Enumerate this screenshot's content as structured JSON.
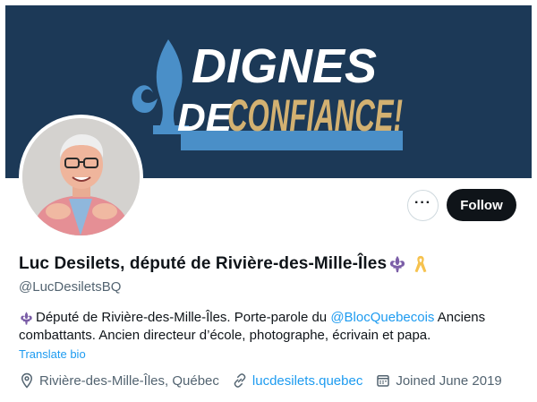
{
  "banner": {
    "line1": "DIGNES",
    "line2_prefix": "DE",
    "line2_main": "CONFIANCE!",
    "colors": {
      "background": "#1c3957",
      "text_white": "#ffffff",
      "text_gold": "#d3b171",
      "accent_blue": "#4a8fc8"
    }
  },
  "profile": {
    "avatar_icon": "profile-photo",
    "more_icon": "more-horizontal-icon",
    "more_label": "···",
    "follow_label": "Follow",
    "display_name": "Luc Desilets, député de Rivière-des-Mille-Îles",
    "name_emojis": [
      "fleur-de-lis-icon",
      "yellow-ribbon-icon"
    ],
    "handle": "@LucDesiletsBQ",
    "bio": {
      "prefix_icon": "fleur-de-lis-icon",
      "text_before_mention": "Député de Rivière-des-Mille-Îles. Porte-parole du ",
      "mention": "@BlocQuebecois",
      "text_after_mention": " Anciens",
      "line2": "combattants. Ancien directeur d’école, photographe, écrivain et papa."
    },
    "translate_label": "Translate bio",
    "meta": {
      "location_icon": "location-pin-icon",
      "location": "Rivière-des-Mille-Îles, Québec",
      "link_icon": "link-icon",
      "website": "lucdesilets.quebec",
      "joined_icon": "calendar-icon",
      "joined": "Joined June 2019"
    }
  },
  "colors": {
    "link": "#1d9bf0",
    "secondary_text": "#536471",
    "primary_text": "#0f1419",
    "follow_bg": "#0f1419"
  }
}
